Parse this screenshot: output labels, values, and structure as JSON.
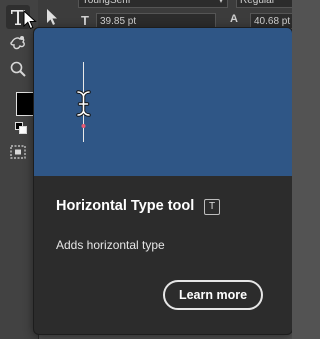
{
  "control_bar": {
    "font_family": "YoungSerif",
    "font_style": "Regular",
    "font_size": "39.85 pt",
    "leading": "40.68 pt"
  },
  "toolbar": {
    "active_tool_icon": "type-tool-icon",
    "fill_color": "#000000"
  },
  "tooltip": {
    "title": "Horizontal Type tool",
    "shortcut": "T",
    "description": "Adds horizontal type",
    "learn_more_label": "Learn more",
    "preview_color": "#2f5686"
  }
}
